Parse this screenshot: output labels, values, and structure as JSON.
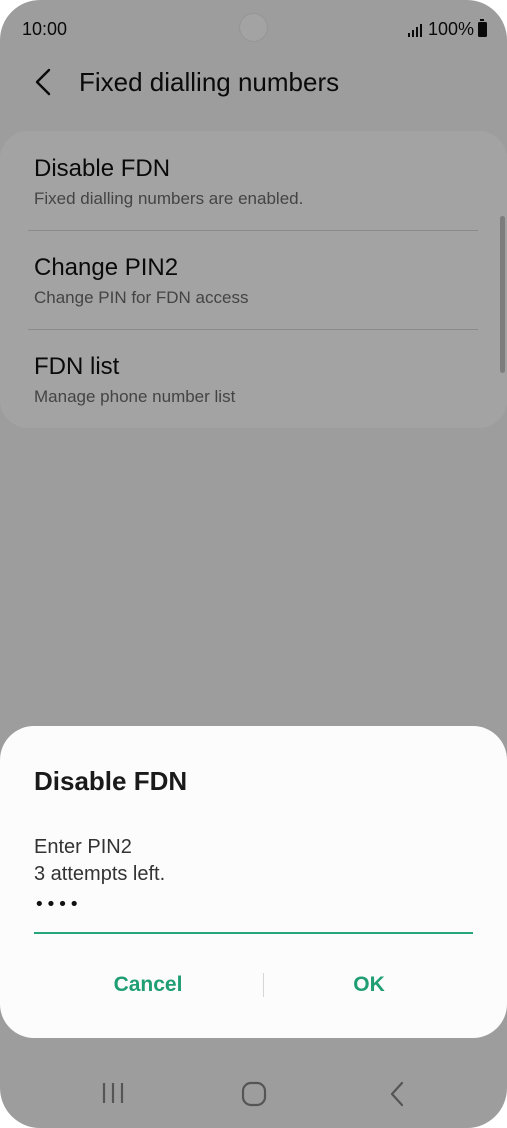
{
  "status_bar": {
    "time": "10:00",
    "battery": "100%",
    "icons": [
      "signal-icon",
      "battery-icon"
    ]
  },
  "header": {
    "title": "Fixed dialling numbers",
    "back_icon": "chevron-left-icon"
  },
  "settings": {
    "items": [
      {
        "title": "Disable FDN",
        "subtitle": "Fixed dialling numbers are enabled."
      },
      {
        "title": "Change PIN2",
        "subtitle": "Change PIN for FDN access"
      },
      {
        "title": "FDN list",
        "subtitle": "Manage phone number list"
      }
    ]
  },
  "dialog": {
    "title": "Disable FDN",
    "message_line1": "Enter PIN2",
    "message_line2": "3 attempts left.",
    "pin_value": "••••",
    "cancel_label": "Cancel",
    "ok_label": "OK"
  },
  "nav_bar": {
    "icons": [
      "recents-icon",
      "home-icon",
      "back-icon"
    ]
  },
  "colors": {
    "accent": "#1f9e74",
    "field_underline": "#27a67c",
    "background": "#f6f6f6",
    "scrim": "rgba(0,0,0,0.36)"
  }
}
